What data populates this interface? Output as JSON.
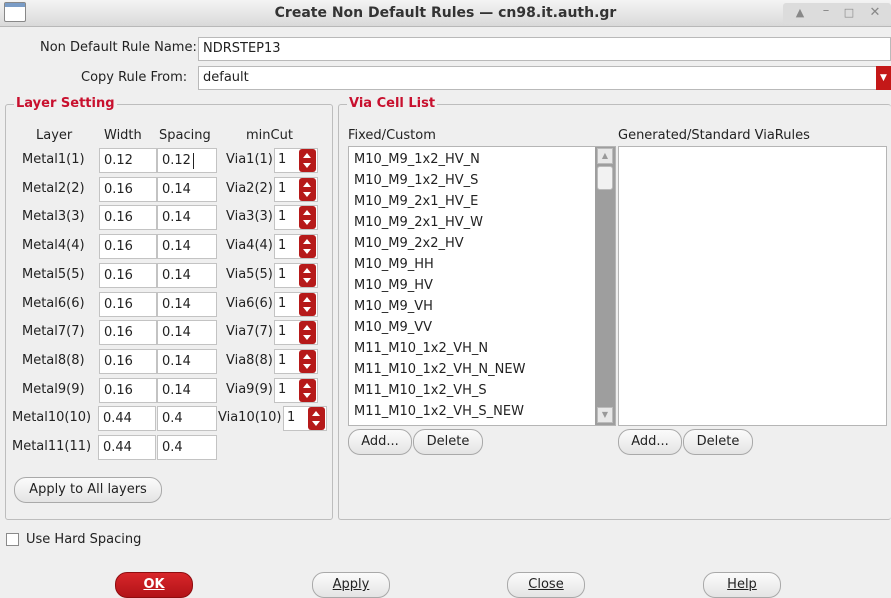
{
  "window": {
    "title": "Create Non Default Rules — cn98.it.auth.gr"
  },
  "form": {
    "ndr_name_label": "Non Default Rule Name:",
    "ndr_name_value": "NDRSTEP13",
    "copy_from_label": "Copy Rule From:",
    "copy_from_value": "default"
  },
  "layer_setting": {
    "title": "Layer Setting",
    "headers": {
      "layer": "Layer",
      "width": "Width",
      "spacing": "Spacing",
      "mincut": "minCut"
    },
    "rows": [
      {
        "layer": "Metal1(1)",
        "width": "0.12",
        "spacing": "0.12",
        "via": "Via1(1)",
        "mincut": "1"
      },
      {
        "layer": "Metal2(2)",
        "width": "0.16",
        "spacing": "0.14",
        "via": "Via2(2)",
        "mincut": "1"
      },
      {
        "layer": "Metal3(3)",
        "width": "0.16",
        "spacing": "0.14",
        "via": "Via3(3)",
        "mincut": "1"
      },
      {
        "layer": "Metal4(4)",
        "width": "0.16",
        "spacing": "0.14",
        "via": "Via4(4)",
        "mincut": "1"
      },
      {
        "layer": "Metal5(5)",
        "width": "0.16",
        "spacing": "0.14",
        "via": "Via5(5)",
        "mincut": "1"
      },
      {
        "layer": "Metal6(6)",
        "width": "0.16",
        "spacing": "0.14",
        "via": "Via6(6)",
        "mincut": "1"
      },
      {
        "layer": "Metal7(7)",
        "width": "0.16",
        "spacing": "0.14",
        "via": "Via7(7)",
        "mincut": "1"
      },
      {
        "layer": "Metal8(8)",
        "width": "0.16",
        "spacing": "0.14",
        "via": "Via8(8)",
        "mincut": "1"
      },
      {
        "layer": "Metal9(9)",
        "width": "0.16",
        "spacing": "0.14",
        "via": "Via9(9)",
        "mincut": "1"
      },
      {
        "layer": "Metal10(10)",
        "width": "0.44",
        "spacing": "0.4",
        "via": "Via10(10)",
        "mincut": "1"
      },
      {
        "layer": "Metal11(11)",
        "width": "0.44",
        "spacing": "0.4"
      }
    ],
    "apply_all_label": "Apply to All layers"
  },
  "via_cell_list": {
    "title": "Via Cell List",
    "fixed_label": "Fixed/Custom",
    "generated_label": "Generated/Standard ViaRules",
    "fixed_items": [
      "M10_M9_1x2_HV_N",
      "M10_M9_1x2_HV_S",
      "M10_M9_2x1_HV_E",
      "M10_M9_2x1_HV_W",
      "M10_M9_2x2_HV",
      "M10_M9_HH",
      "M10_M9_HV",
      "M10_M9_VH",
      "M10_M9_VV",
      "M11_M10_1x2_VH_N",
      "M11_M10_1x2_VH_N_NEW",
      "M11_M10_1x2_VH_S",
      "M11_M10_1x2_VH_S_NEW"
    ],
    "generated_items": [],
    "add_label": "Add...",
    "delete_label": "Delete"
  },
  "hard_spacing": {
    "label": "Use Hard Spacing",
    "checked": false
  },
  "buttons": {
    "ok": "OK",
    "apply": "Apply",
    "close": "Close",
    "help": "Help"
  }
}
